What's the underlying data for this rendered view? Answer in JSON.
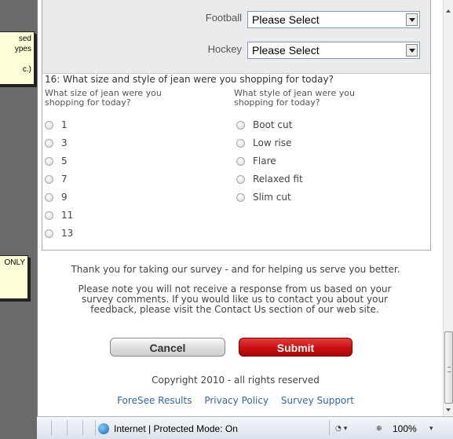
{
  "notes": {
    "note1_lines": [
      "sed",
      "ypes",
      "",
      "c.)"
    ],
    "note2_text": "ONLY"
  },
  "sports": [
    {
      "label": "Football",
      "value": "Please Select"
    },
    {
      "label": "Hockey",
      "value": "Please Select"
    }
  ],
  "question": {
    "title": "16: What size and style of jean were you shopping for today?",
    "size_label_1": "What size of jean were you",
    "size_label_2": "shopping for today?",
    "style_label_1": "What style of jean were you",
    "style_label_2": "shopping for today?",
    "sizes": [
      "1",
      "3",
      "5",
      "7",
      "9",
      "11",
      "13"
    ],
    "styles": [
      "Boot cut",
      "Low rise",
      "Flare",
      "Relaxed fit",
      "Slim cut"
    ]
  },
  "thanks": "Thank you for taking our survey - and for helping us serve you better.",
  "notice_lines": [
    "Please note you will not receive a response from us based on your",
    "survey comments. If you would like us to contact you about your",
    "feedback, please visit the Contact Us section of our web site."
  ],
  "buttons": {
    "cancel": "Cancel",
    "submit": "Submit"
  },
  "copyright": "Copyright 2010 - all rights reserved",
  "links": [
    "ForeSee Results",
    "Privacy Policy",
    "Survey Support"
  ],
  "statusbar": {
    "zone": "Internet | Protected Mode: On",
    "zoom": "100%"
  }
}
